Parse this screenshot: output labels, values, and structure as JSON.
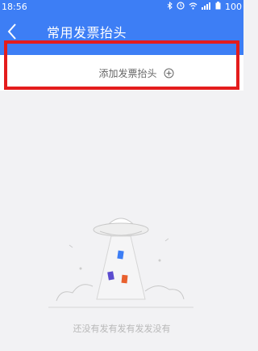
{
  "status_bar": {
    "time": "18:56",
    "battery": "100",
    "icons": [
      "bluetooth-icon",
      "alarm-icon",
      "wifi-icon",
      "signal-icon",
      "battery-icon"
    ]
  },
  "nav": {
    "title": "常用发票抬头",
    "back_icon": "chevron-left-icon"
  },
  "add_row": {
    "label": "添加发票抬头",
    "icon": "add-circle-icon"
  },
  "empty_state": {
    "message": "还没有发有发有发发没有",
    "illustration": "ufo-beaming-invoices"
  },
  "colors": {
    "header": "#3d7ef5",
    "background": "#f2f2f4",
    "highlight": "#e41c1c"
  }
}
